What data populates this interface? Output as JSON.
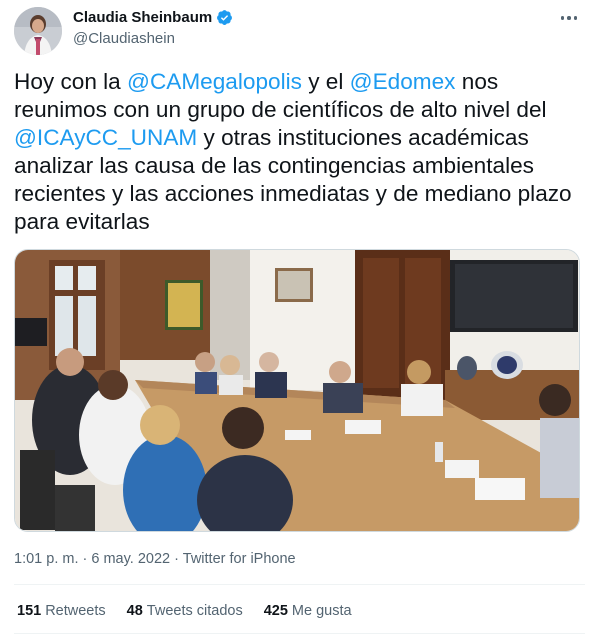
{
  "author": {
    "display_name": "Claudia Sheinbaum",
    "handle": "@Claudiashein",
    "verified": true
  },
  "tweet": {
    "segments": [
      {
        "text": "Hoy con la ",
        "type": "text"
      },
      {
        "text": "@CAMegalopolis",
        "type": "mention"
      },
      {
        "text": " y el ",
        "type": "text"
      },
      {
        "text": "@Edomex",
        "type": "mention"
      },
      {
        "text": " nos reunimos con un grupo de científicos de alto nivel del ",
        "type": "text"
      },
      {
        "text": "@ICAyCC_UNAM",
        "type": "mention"
      },
      {
        "text": " y otras instituciones académicas analizar las causa de las contingencias ambientales recientes y las acciones inmediatas y de mediano plazo para evitarlas",
        "type": "text"
      }
    ]
  },
  "meta": {
    "time": "1:01 p. m.",
    "separator": "·",
    "date": "6 may. 2022",
    "source": "Twitter for iPhone"
  },
  "stats": {
    "retweets_count": "151",
    "retweets_label": "Retweets",
    "quotes_count": "48",
    "quotes_label": "Tweets citados",
    "likes_count": "425",
    "likes_label": "Me gusta"
  },
  "colors": {
    "accent": "#1d9bf0",
    "text_primary": "#0f1419",
    "text_secondary": "#536471",
    "divider": "#eff3f4"
  },
  "icons": {
    "verified": "verified-badge-icon",
    "more": "more-options-icon"
  }
}
